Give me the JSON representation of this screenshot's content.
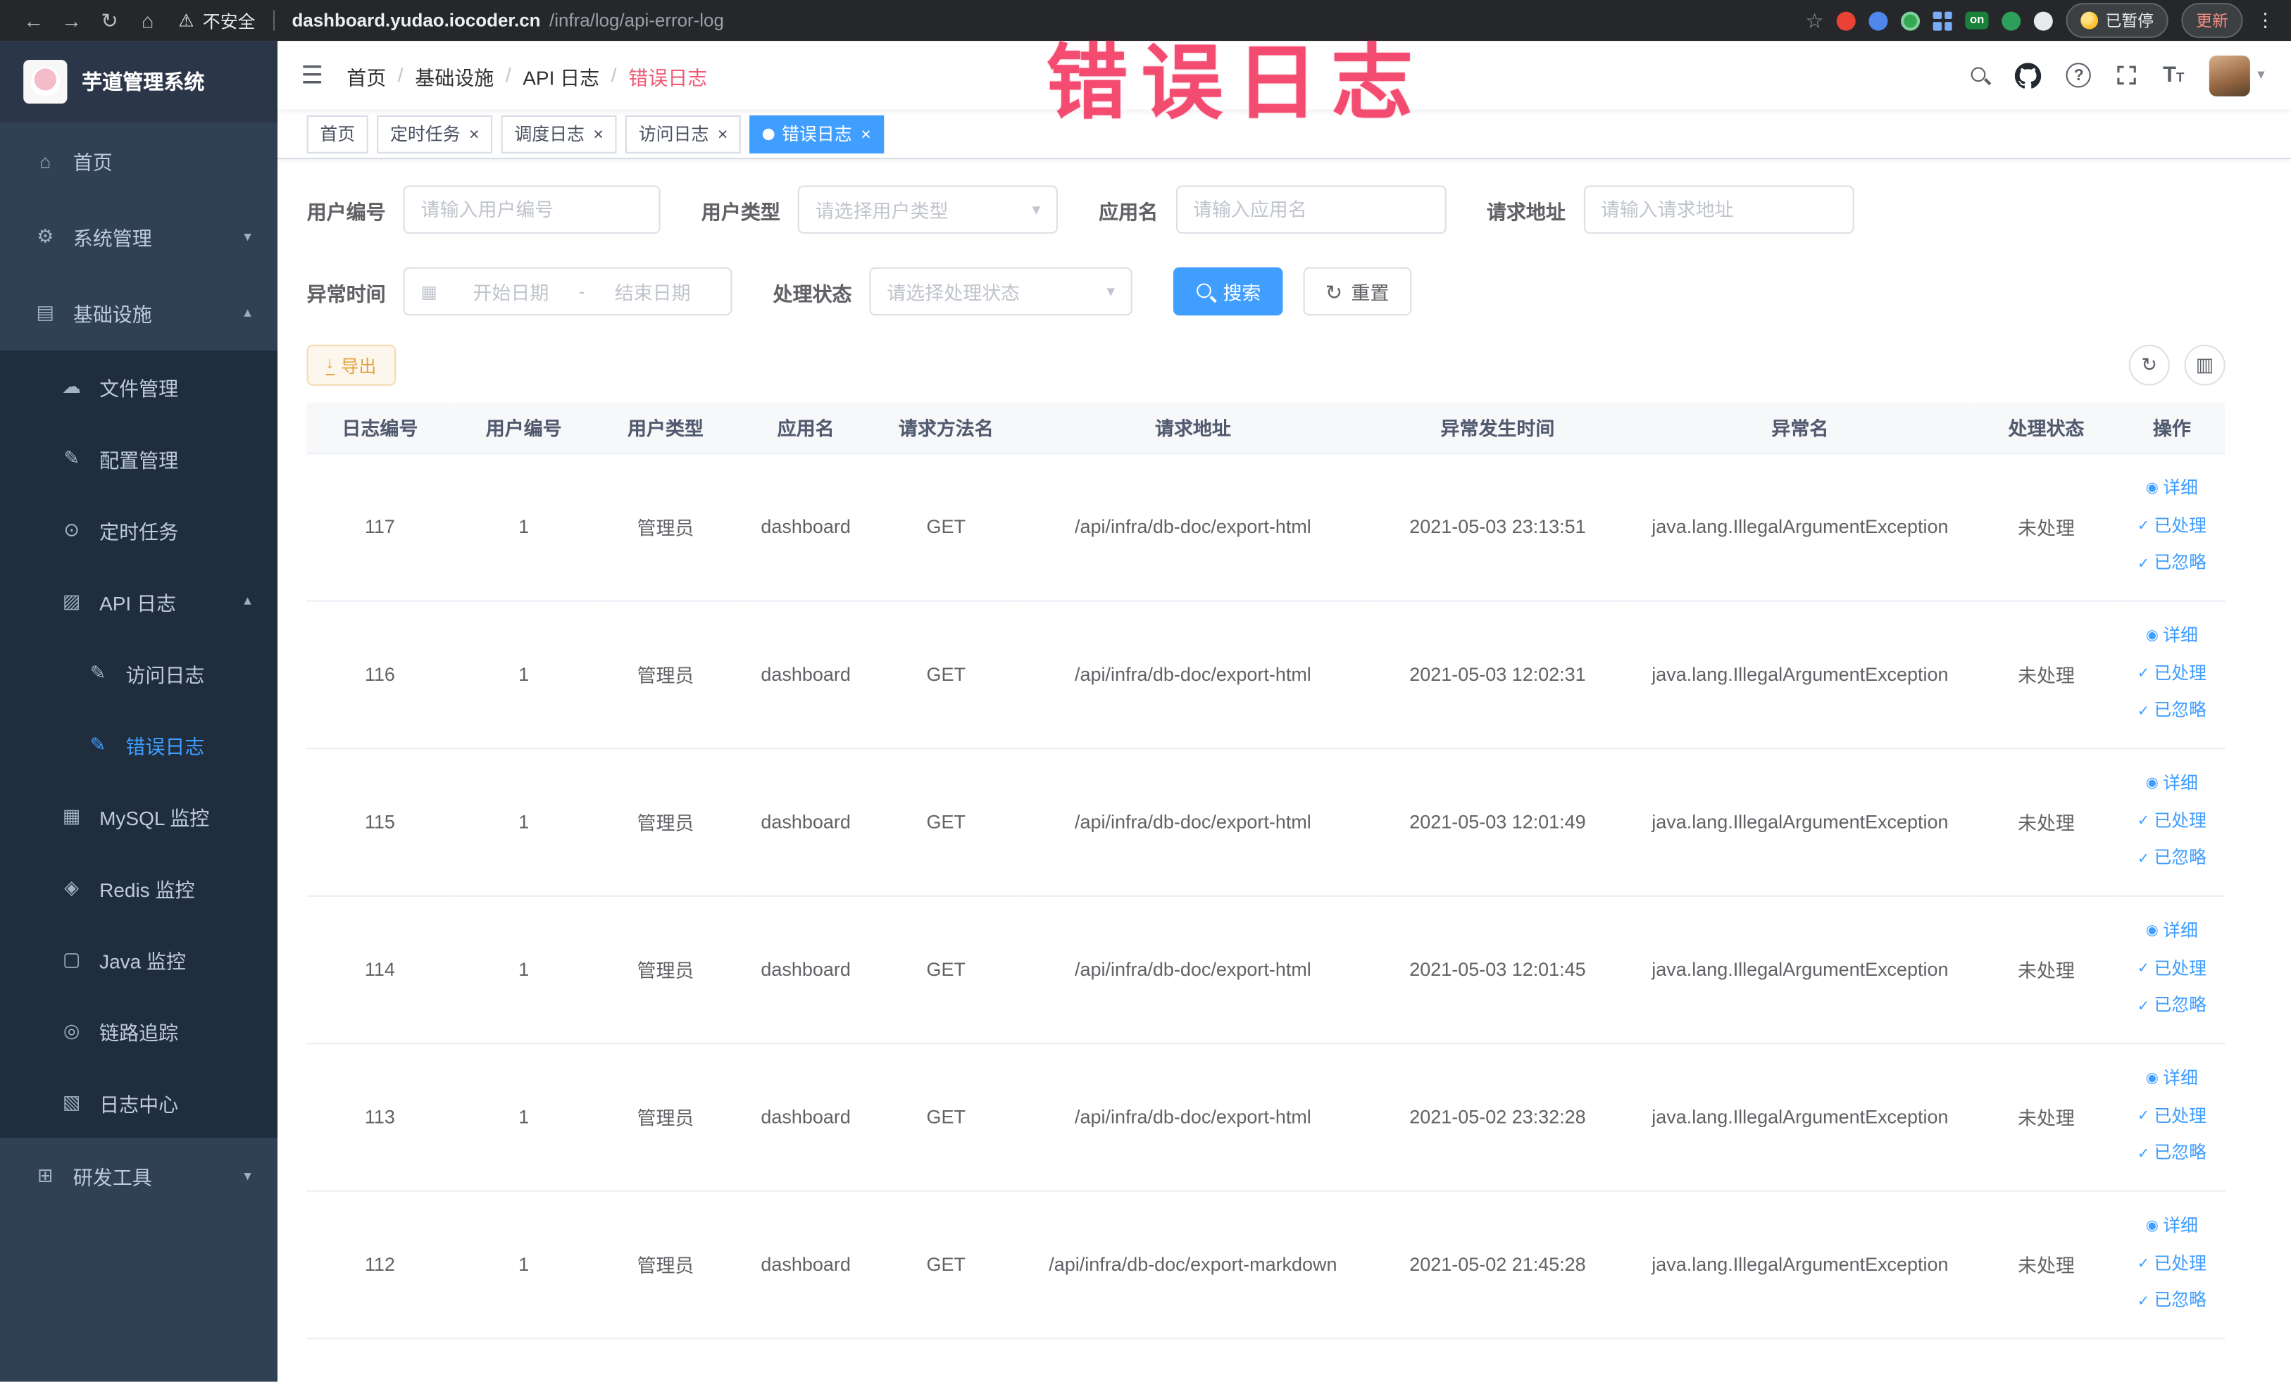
{
  "browser": {
    "security_label": "不安全",
    "url_domain": "dashboard.yudao.iocoder.cn",
    "url_path": "/infra/log/api-error-log",
    "on_badge": "on",
    "paused_label": "已暂停",
    "update_label": "更新"
  },
  "annotation": {
    "text": "错误日志"
  },
  "sidebar": {
    "logo_title": "芋道管理系统",
    "items": [
      {
        "label": "首页",
        "icon": "home-icon",
        "level": 0
      },
      {
        "label": "系统管理",
        "icon": "gear-icon",
        "level": 0,
        "chevron": "down"
      },
      {
        "label": "基础设施",
        "icon": "monitor-icon",
        "level": 0,
        "chevron": "up"
      },
      {
        "label": "文件管理",
        "icon": "cloud-icon",
        "level": 1
      },
      {
        "label": "配置管理",
        "icon": "edit-icon",
        "level": 1
      },
      {
        "label": "定时任务",
        "icon": "clock-icon",
        "level": 1
      },
      {
        "label": "API 日志",
        "icon": "api-log-icon",
        "level": 1,
        "chevron": "up"
      },
      {
        "label": "访问日志",
        "icon": "access-log-icon",
        "level": 2
      },
      {
        "label": "错误日志",
        "icon": "error-log-icon",
        "level": 2,
        "active": true
      },
      {
        "label": "MySQL 监控",
        "icon": "mysql-icon",
        "level": 1
      },
      {
        "label": "Redis 监控",
        "icon": "redis-icon",
        "level": 1
      },
      {
        "label": "Java 监控",
        "icon": "java-icon",
        "level": 1
      },
      {
        "label": "链路追踪",
        "icon": "trace-icon",
        "level": 1
      },
      {
        "label": "日志中心",
        "icon": "log-center-icon",
        "level": 1
      },
      {
        "label": "研发工具",
        "icon": "tools-icon",
        "level": 0,
        "chevron": "down"
      }
    ]
  },
  "header": {
    "breadcrumb": [
      "首页",
      "基础设施",
      "API 日志",
      "错误日志"
    ]
  },
  "tabs": [
    {
      "label": "首页",
      "closable": false,
      "active": false
    },
    {
      "label": "定时任务",
      "closable": true,
      "active": false
    },
    {
      "label": "调度日志",
      "closable": true,
      "active": false
    },
    {
      "label": "访问日志",
      "closable": true,
      "active": false
    },
    {
      "label": "错误日志",
      "closable": true,
      "active": true
    }
  ],
  "filters": {
    "user_id_label": "用户编号",
    "user_id_placeholder": "请输入用户编号",
    "user_type_label": "用户类型",
    "user_type_placeholder": "请选择用户类型",
    "app_name_label": "应用名",
    "app_name_placeholder": "请输入应用名",
    "request_url_label": "请求地址",
    "request_url_placeholder": "请输入请求地址",
    "exception_time_label": "异常时间",
    "date_start_placeholder": "开始日期",
    "date_separator": "-",
    "date_end_placeholder": "结束日期",
    "process_status_label": "处理状态",
    "process_status_placeholder": "请选择处理状态",
    "search_label": "搜索",
    "reset_label": "重置"
  },
  "toolbar": {
    "export_label": "导出"
  },
  "table": {
    "columns": [
      "日志编号",
      "用户编号",
      "用户类型",
      "应用名",
      "请求方法名",
      "请求地址",
      "异常发生时间",
      "异常名",
      "处理状态",
      "操作"
    ],
    "rows": [
      {
        "id": "117",
        "user_id": "1",
        "user_type": "管理员",
        "app": "dashboard",
        "method": "GET",
        "url": "/api/infra/db-doc/export-html",
        "time": "2021-05-03 23:13:51",
        "exception": "java.lang.IllegalArgumentException",
        "status": "未处理"
      },
      {
        "id": "116",
        "user_id": "1",
        "user_type": "管理员",
        "app": "dashboard",
        "method": "GET",
        "url": "/api/infra/db-doc/export-html",
        "time": "2021-05-03 12:02:31",
        "exception": "java.lang.IllegalArgumentException",
        "status": "未处理"
      },
      {
        "id": "115",
        "user_id": "1",
        "user_type": "管理员",
        "app": "dashboard",
        "method": "GET",
        "url": "/api/infra/db-doc/export-html",
        "time": "2021-05-03 12:01:49",
        "exception": "java.lang.IllegalArgumentException",
        "status": "未处理"
      },
      {
        "id": "114",
        "user_id": "1",
        "user_type": "管理员",
        "app": "dashboard",
        "method": "GET",
        "url": "/api/infra/db-doc/export-html",
        "time": "2021-05-03 12:01:45",
        "exception": "java.lang.IllegalArgumentException",
        "status": "未处理"
      },
      {
        "id": "113",
        "user_id": "1",
        "user_type": "管理员",
        "app": "dashboard",
        "method": "GET",
        "url": "/api/infra/db-doc/export-html",
        "time": "2021-05-02 23:32:28",
        "exception": "java.lang.IllegalArgumentException",
        "status": "未处理"
      },
      {
        "id": "112",
        "user_id": "1",
        "user_type": "管理员",
        "app": "dashboard",
        "method": "GET",
        "url": "/api/infra/db-doc/export-markdown",
        "time": "2021-05-02 21:45:28",
        "exception": "java.lang.IllegalArgumentException",
        "status": "未处理"
      }
    ],
    "actions": [
      {
        "label": "详细",
        "icon": "eye-icon"
      },
      {
        "label": "已处理",
        "icon": "check-icon"
      },
      {
        "label": "已忽略",
        "icon": "check-icon"
      }
    ]
  },
  "colors": {
    "accent": "#409eff",
    "annotation": "#f34c70",
    "warning": "#e6a23c",
    "sidebar_bg": "#304156",
    "sidebar_submenu_bg": "#1f2d3d"
  }
}
